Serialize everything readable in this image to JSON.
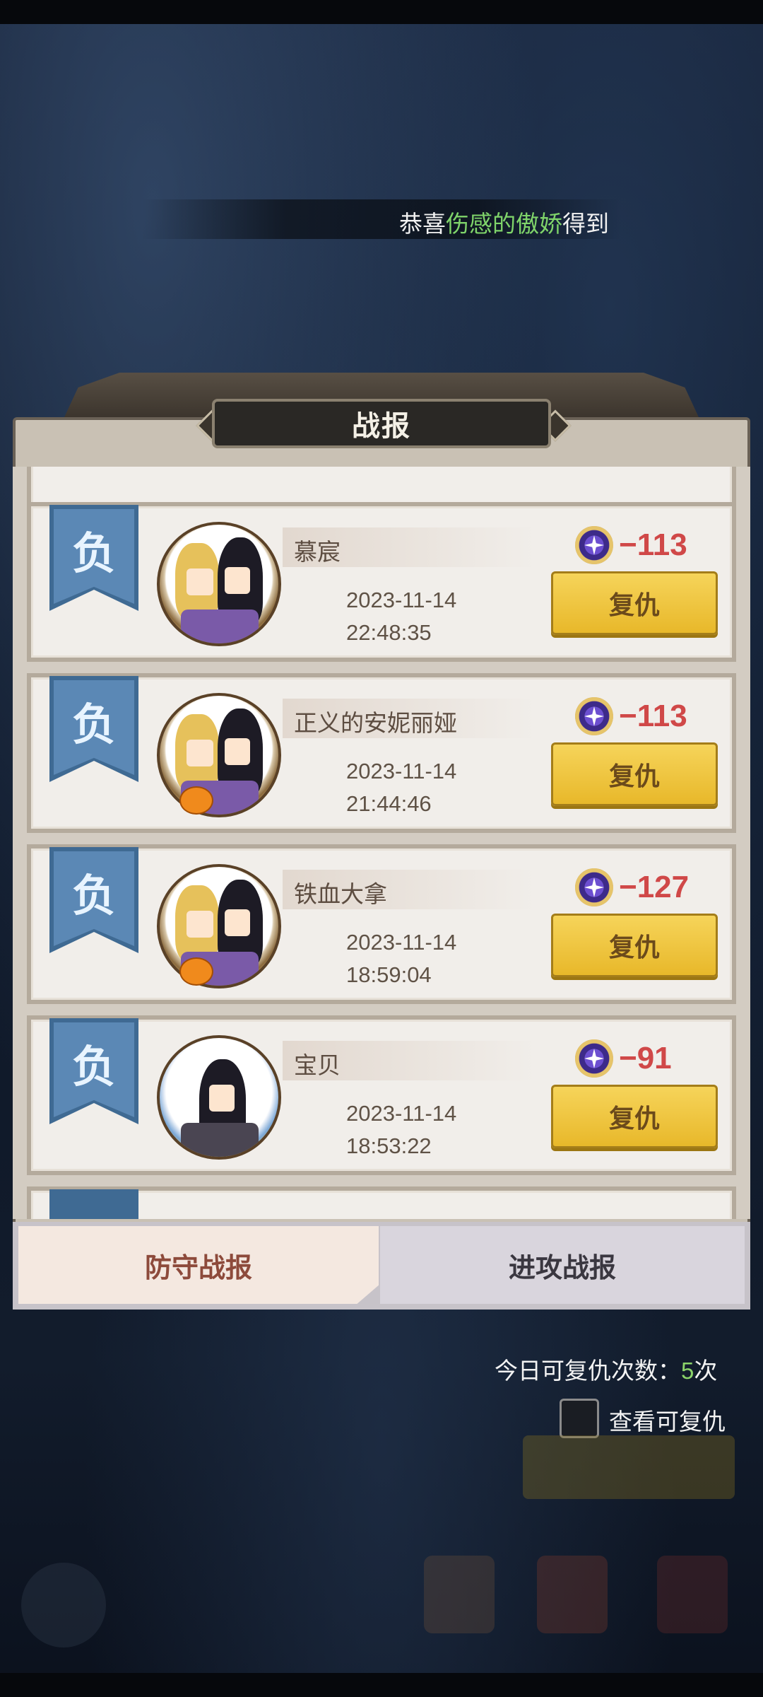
{
  "banner": {
    "prefix": "恭喜",
    "highlight": "伤感的傲娇",
    "suffix": "得到"
  },
  "panel": {
    "title": "战报"
  },
  "records": [
    {
      "result": "负",
      "name": "慕宸",
      "date": "2023-11-14",
      "time": "22:48:35",
      "score": "−113",
      "button": "复仇"
    },
    {
      "result": "负",
      "name": "正义的安妮丽娅",
      "date": "2023-11-14",
      "time": "21:44:46",
      "score": "−113",
      "button": "复仇"
    },
    {
      "result": "负",
      "name": "铁血大拿",
      "date": "2023-11-14",
      "time": "18:59:04",
      "score": "−127",
      "button": "复仇"
    },
    {
      "result": "负",
      "name": "宝贝",
      "date": "2023-11-14",
      "time": "18:53:22",
      "score": "−91",
      "button": "复仇"
    }
  ],
  "tabs": {
    "defense": "防守战报",
    "attack": "进攻战报"
  },
  "footer": {
    "revenge_label": "今日可复仇次数：",
    "revenge_count": "5",
    "revenge_unit": "次",
    "checkbox_label": "查看可复仇"
  },
  "icons": {
    "score_icon": "star-medal-icon",
    "result_badge": "ribbon-badge-icon"
  },
  "colors": {
    "loss_red": "#d04848",
    "button_gold": "#f0c43c",
    "highlight_green": "#7fd46a"
  }
}
